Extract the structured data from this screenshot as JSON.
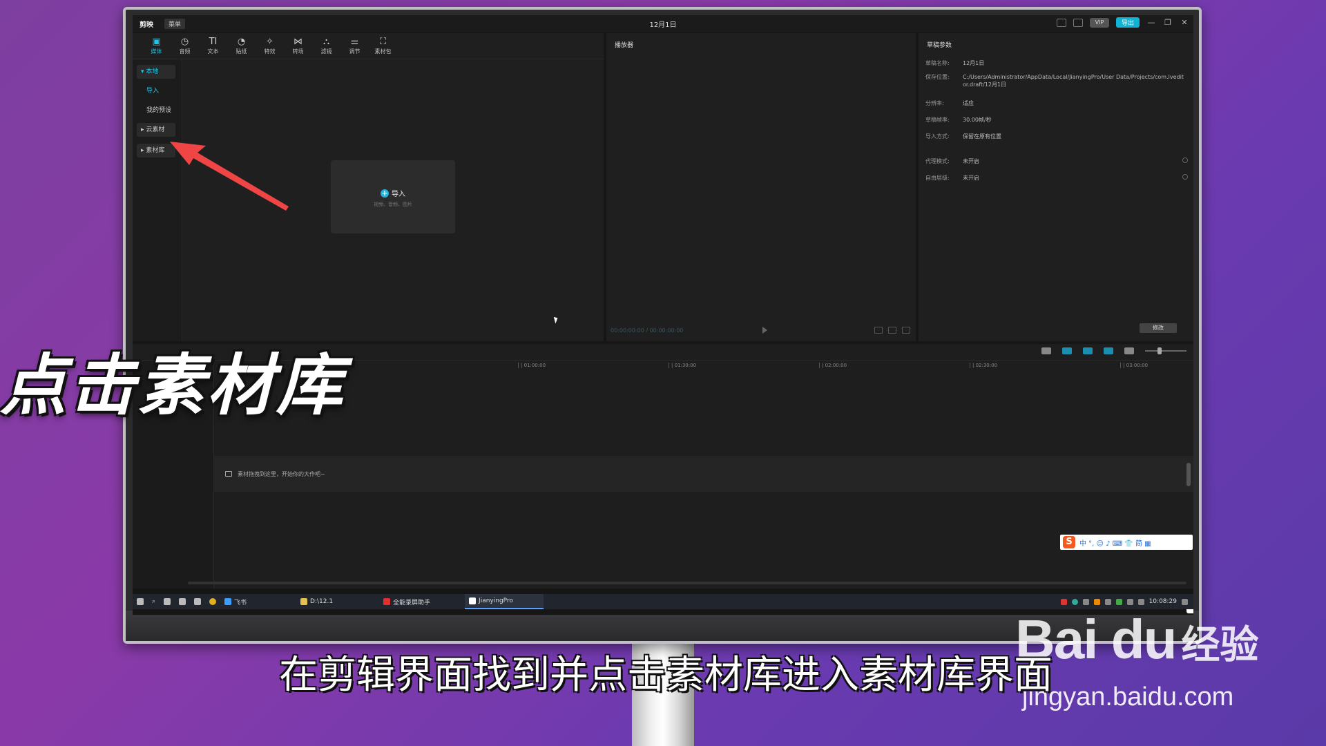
{
  "titlebar": {
    "app_name": "剪映",
    "menu_label": "菜单",
    "project_title": "12月1日",
    "export_label": "导出",
    "vip_label": "VIP"
  },
  "toolbar": {
    "items": [
      {
        "label": "媒体",
        "icon": "media-icon"
      },
      {
        "label": "音频",
        "icon": "audio-icon"
      },
      {
        "label": "文本",
        "icon": "text-icon"
      },
      {
        "label": "贴纸",
        "icon": "sticker-icon"
      },
      {
        "label": "特效",
        "icon": "effects-icon"
      },
      {
        "label": "转场",
        "icon": "transition-icon"
      },
      {
        "label": "滤镜",
        "icon": "filter-icon"
      },
      {
        "label": "调节",
        "icon": "adjust-icon"
      },
      {
        "label": "素材包",
        "icon": "package-icon"
      }
    ]
  },
  "sidebar": {
    "items": [
      {
        "label": "本地"
      },
      {
        "label": "导入"
      },
      {
        "label": "我的预设"
      },
      {
        "label": "云素材"
      },
      {
        "label": "素材库"
      }
    ]
  },
  "media": {
    "import_label": "导入",
    "import_sub": "视频、音频、图片"
  },
  "player": {
    "title": "播放器",
    "timecode": "00:00:00:00 / 00:00:00:00"
  },
  "props": {
    "title": "草稿参数",
    "rows": [
      {
        "key": "草稿名称:",
        "value": "12月1日"
      },
      {
        "key": "保存位置:",
        "value": "C:/Users/Administrator/AppData/Local/JianyingPro/User Data/Projects/com.lveditor.draft/12月1日"
      },
      {
        "key": "分辨率:",
        "value": "适应"
      },
      {
        "key": "草稿帧率:",
        "value": "30.00帧/秒"
      },
      {
        "key": "导入方式:",
        "value": "保留在原有位置"
      },
      {
        "key": "代理模式:",
        "value": "未开启"
      },
      {
        "key": "自由层级:",
        "value": "未开启"
      }
    ],
    "modify_label": "修改"
  },
  "timeline": {
    "ticks": [
      "| 01:00:00",
      "| 01:30:00",
      "| 02:00:00",
      "| 02:30:00",
      "| 03:00:00"
    ],
    "drop_hint": "素材拖拽到这里，开始你的大作吧~"
  },
  "ime": {
    "chars": "中 °, ☺ ♪ ⌨ 👕 简 ▦"
  },
  "taskbar": {
    "items": [
      {
        "label": "飞书"
      },
      {
        "label": "D:\\12.1"
      },
      {
        "label": "全能录屏助手"
      },
      {
        "label": "JianyingPro"
      }
    ],
    "clock": "10:08:29"
  },
  "overlay": {
    "caption": "点击素材库",
    "subtitle": "在剪辑界面找到并点击素材库进入素材库界面",
    "watermark_logo": "Bai du",
    "watermark_jy": "经验",
    "watermark_url": "jingyan.baidu.com"
  }
}
